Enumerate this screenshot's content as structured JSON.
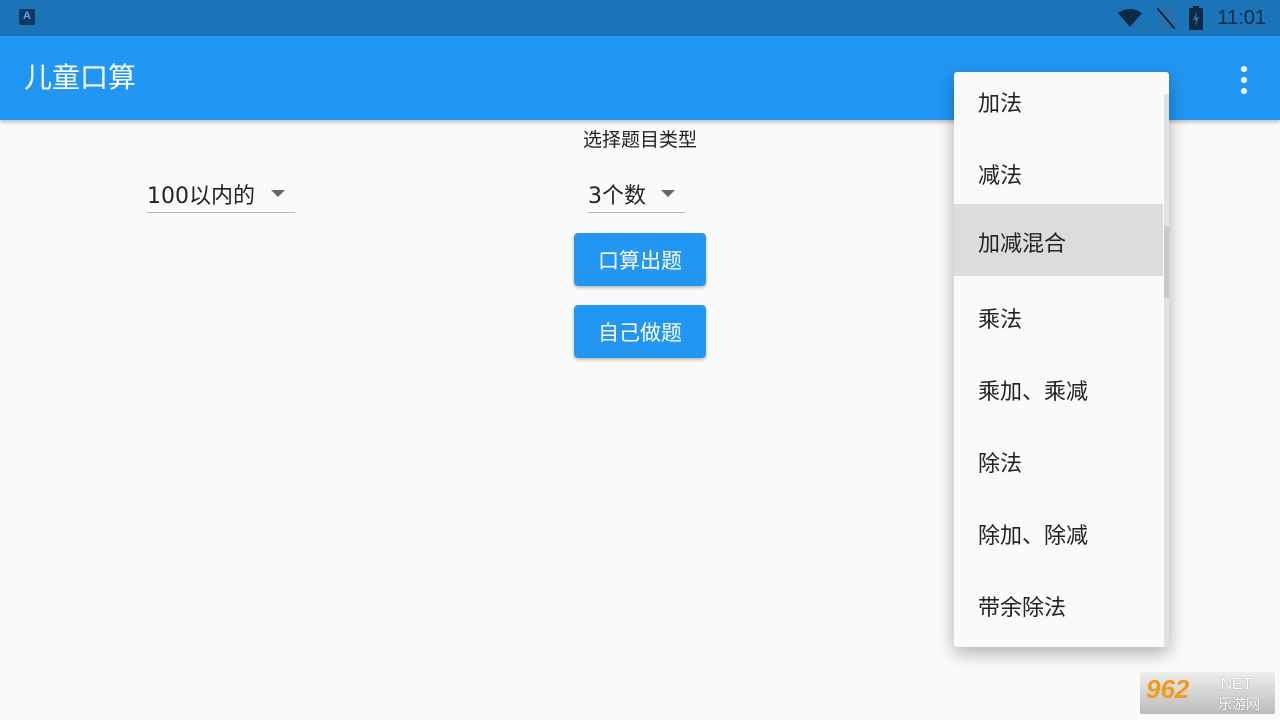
{
  "status_bar": {
    "app_icon_letter": "A",
    "time": "11:01",
    "icons": [
      "wifi-icon",
      "no-sim-icon",
      "battery-charging-icon"
    ]
  },
  "app_bar": {
    "title": "儿童口算",
    "overflow_icon": "more-vert-icon",
    "color": "#2196f3"
  },
  "main": {
    "type_label": "选择题目类型",
    "range_dropdown": {
      "selected": "100以内的"
    },
    "count_dropdown": {
      "selected": "3个数"
    },
    "buttons": {
      "generate": "口算出题",
      "self": "自己做题"
    }
  },
  "type_menu": {
    "selected_index": 2,
    "items": [
      {
        "label": "加法"
      },
      {
        "label": "减法"
      },
      {
        "label": "加减混合"
      },
      {
        "label": "乘法"
      },
      {
        "label": "乘加、乘减"
      },
      {
        "label": "除法"
      },
      {
        "label": "除加、除减"
      },
      {
        "label": "带余除法"
      }
    ]
  },
  "watermark": {
    "number": "962",
    "domain": ".NET",
    "cn": "乐游网"
  }
}
